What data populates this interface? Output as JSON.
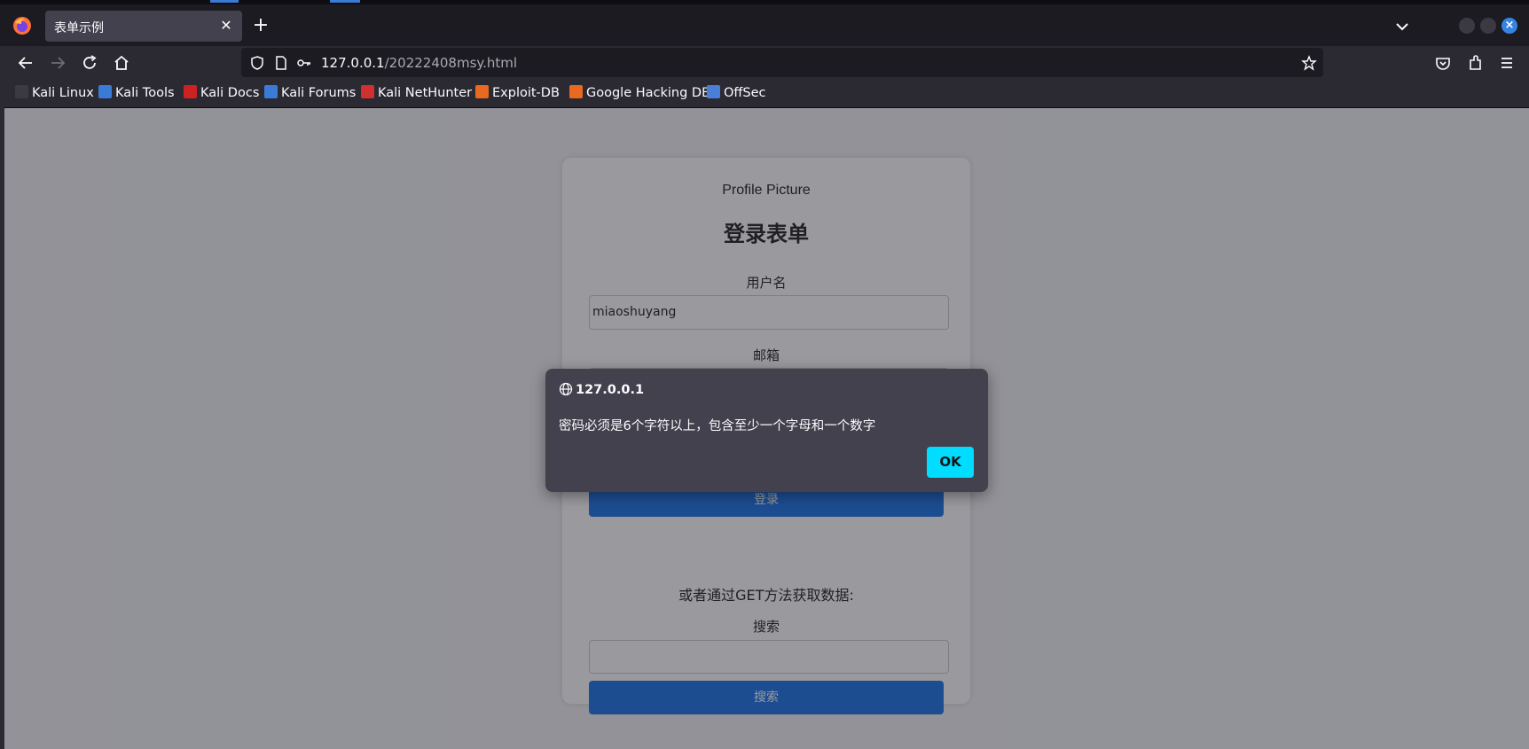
{
  "browser": {
    "tab_title": "表单示例",
    "tab_close": "✕",
    "new_tab": "+",
    "url_host": "127.0.0.1",
    "url_path": "/20222408msy.html",
    "accent_color": "#00ddff"
  },
  "bookmarks": [
    {
      "label": "Kali Linux",
      "icon": "kali-dragon-icon",
      "color": "#3a3a40"
    },
    {
      "label": "Kali Tools",
      "icon": "kali-tools-icon",
      "color": "#3a7bd5"
    },
    {
      "label": "Kali Docs",
      "icon": "kali-docs-icon",
      "color": "#cc2222"
    },
    {
      "label": "Kali Forums",
      "icon": "kali-forums-icon",
      "color": "#3a7bd5"
    },
    {
      "label": "Kali NetHunter",
      "icon": "nethunter-icon",
      "color": "#d03030"
    },
    {
      "label": "Exploit-DB",
      "icon": "exploit-db-icon",
      "color": "#e8691f"
    },
    {
      "label": "Google Hacking DB",
      "icon": "ghdb-icon",
      "color": "#e8691f"
    },
    {
      "label": "OffSec",
      "icon": "offsec-icon",
      "color": "#4a7fd8"
    }
  ],
  "page": {
    "profile_picture_alt": "Profile Picture",
    "heading": "登录表单",
    "username_label": "用户名",
    "username_value": "miaoshuyang",
    "email_label": "邮箱",
    "login_button": "登录",
    "get_method_text": "或者通过GET方法获取数据:",
    "search_label": "搜索",
    "search_value": "",
    "search_button": "搜索",
    "button_color": "#1a73e8"
  },
  "dialog": {
    "origin": "127.0.0.1",
    "message": "密码必须是6个字符以上，包含至少一个字母和一个数字",
    "ok_label": "OK"
  }
}
